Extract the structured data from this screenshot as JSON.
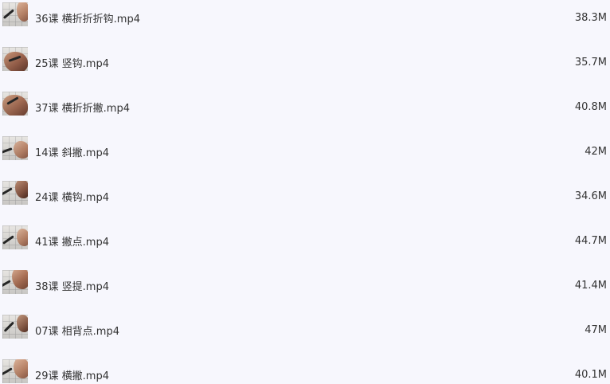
{
  "files": [
    {
      "name": "36课 横折折折钩.mp4",
      "size": "38.3M",
      "thumb_icon": "video-thumbnail-icon"
    },
    {
      "name": "25课 竖钩.mp4",
      "size": "35.7M",
      "thumb_icon": "video-thumbnail-icon"
    },
    {
      "name": "37课 横折折撇.mp4",
      "size": "40.8M",
      "thumb_icon": "video-thumbnail-icon"
    },
    {
      "name": "14课 斜撇.mp4",
      "size": "42M",
      "thumb_icon": "video-thumbnail-icon"
    },
    {
      "name": "24课 横钩.mp4",
      "size": "34.6M",
      "thumb_icon": "video-thumbnail-icon"
    },
    {
      "name": "41课 撇点.mp4",
      "size": "44.7M",
      "thumb_icon": "video-thumbnail-icon"
    },
    {
      "name": "38课 竖提.mp4",
      "size": "41.4M",
      "thumb_icon": "video-thumbnail-icon"
    },
    {
      "name": "07课 相背点.mp4",
      "size": "47M",
      "thumb_icon": "video-thumbnail-icon"
    },
    {
      "name": "29课 横撇.mp4",
      "size": "40.1M",
      "thumb_icon": "video-thumbnail-icon"
    }
  ],
  "colors": {
    "background": "#f7f7fd",
    "text": "#333333"
  }
}
